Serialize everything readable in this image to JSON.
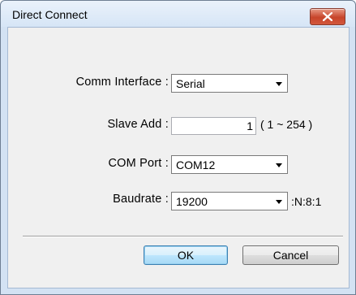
{
  "window": {
    "title": "Direct Connect"
  },
  "form": {
    "comm_interface": {
      "label": "Comm Interface :",
      "value": "Serial"
    },
    "slave_add": {
      "label": "Slave Add :",
      "value": "1",
      "range": "( 1 ~ 254 )"
    },
    "com_port": {
      "label": "COM Port :",
      "value": "COM12"
    },
    "baudrate": {
      "label": "Baudrate :",
      "value": "19200",
      "suffix": ":N:8:1"
    }
  },
  "buttons": {
    "ok": "OK",
    "cancel": "Cancel"
  },
  "icons": {
    "close": "close-icon",
    "dropdown": "chevron-down-icon"
  },
  "colors": {
    "close_button": "#c7452b",
    "frame": "#d3e2f3",
    "client": "#f0f0f0"
  }
}
